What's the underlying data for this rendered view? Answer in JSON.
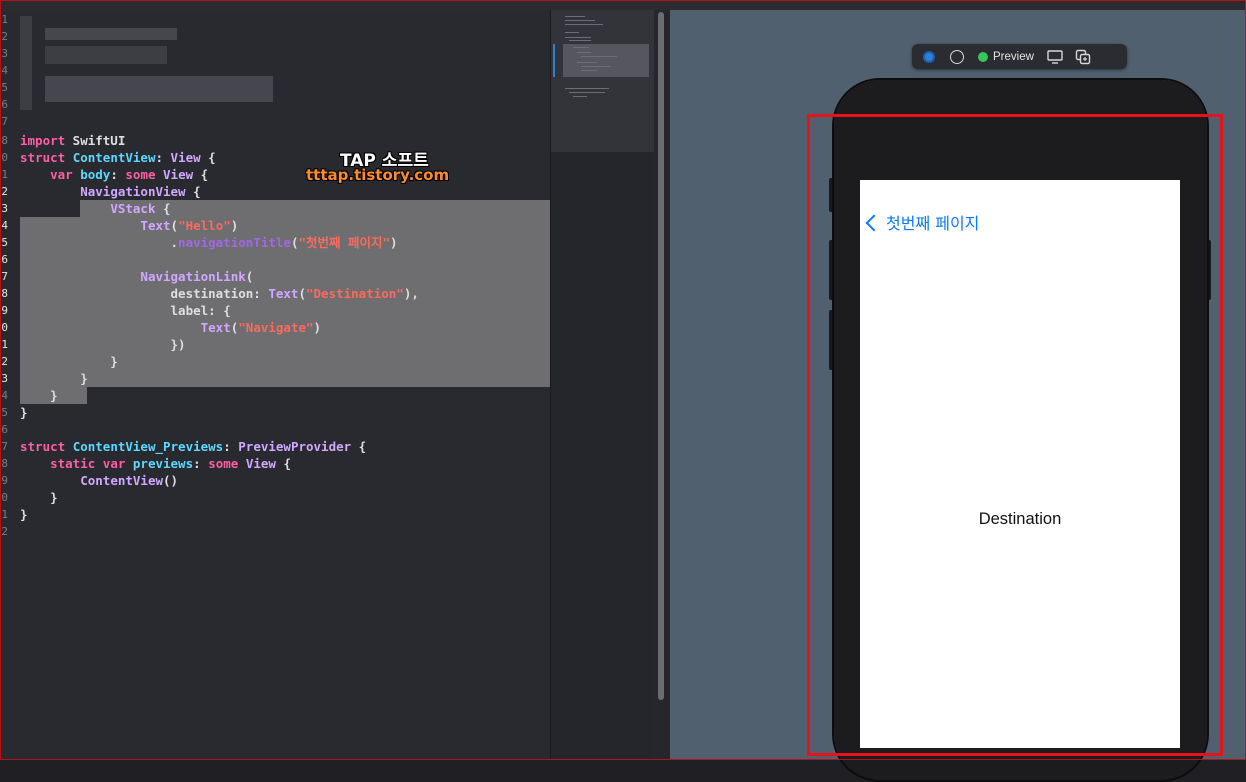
{
  "watermark": {
    "title": "TAP 소프트",
    "url": "tttap.tistory.com"
  },
  "code_lines": [
    {
      "n": "8",
      "tokens": [
        {
          "t": "import",
          "c": "kw"
        },
        {
          "t": " SwiftUI",
          "c": "plain"
        }
      ]
    },
    {
      "n": "0",
      "tokens": [
        {
          "t": "struct",
          "c": "kw"
        },
        {
          "t": " ",
          "c": "plain"
        },
        {
          "t": "ContentView",
          "c": "ty"
        },
        {
          "t": ": ",
          "c": "plain"
        },
        {
          "t": "View",
          "c": "ty2"
        },
        {
          "t": " {",
          "c": "plain"
        }
      ]
    },
    {
      "n": "1",
      "tokens": [
        {
          "t": "    ",
          "c": "plain"
        },
        {
          "t": "var",
          "c": "kw"
        },
        {
          "t": " ",
          "c": "plain"
        },
        {
          "t": "body",
          "c": "ty"
        },
        {
          "t": ": ",
          "c": "plain"
        },
        {
          "t": "some",
          "c": "kw"
        },
        {
          "t": " ",
          "c": "plain"
        },
        {
          "t": "View",
          "c": "ty2"
        },
        {
          "t": " {",
          "c": "plain"
        }
      ]
    },
    {
      "n": "2",
      "tokens": [
        {
          "t": "        ",
          "c": "plain"
        },
        {
          "t": "NavigationView",
          "c": "ty2"
        },
        {
          "t": " {",
          "c": "plain"
        }
      ]
    },
    {
      "n": "3",
      "tokens": [
        {
          "t": "            ",
          "c": "plain"
        },
        {
          "t": "VStack",
          "c": "ty2"
        },
        {
          "t": " {",
          "c": "plain"
        }
      ]
    },
    {
      "n": "4",
      "tokens": [
        {
          "t": "                ",
          "c": "plain"
        },
        {
          "t": "Text",
          "c": "ty2"
        },
        {
          "t": "(",
          "c": "plain"
        },
        {
          "t": "\"Hello\"",
          "c": "str"
        },
        {
          "t": ")",
          "c": "plain"
        }
      ]
    },
    {
      "n": "5",
      "tokens": [
        {
          "t": "                    .",
          "c": "plain"
        },
        {
          "t": "navigationTitle",
          "c": "mth"
        },
        {
          "t": "(",
          "c": "plain"
        },
        {
          "t": "\"첫번째 페이지\"",
          "c": "str"
        },
        {
          "t": ")",
          "c": "plain"
        }
      ]
    },
    {
      "n": "6",
      "tokens": []
    },
    {
      "n": "7",
      "tokens": [
        {
          "t": "                ",
          "c": "plain"
        },
        {
          "t": "NavigationLink",
          "c": "ty2"
        },
        {
          "t": "(",
          "c": "plain"
        }
      ]
    },
    {
      "n": "8",
      "tokens": [
        {
          "t": "                    destination: ",
          "c": "plain"
        },
        {
          "t": "Text",
          "c": "ty2"
        },
        {
          "t": "(",
          "c": "plain"
        },
        {
          "t": "\"Destination\"",
          "c": "str"
        },
        {
          "t": "),",
          "c": "plain"
        }
      ]
    },
    {
      "n": "9",
      "tokens": [
        {
          "t": "                    label: {",
          "c": "plain"
        }
      ]
    },
    {
      "n": "0",
      "tokens": [
        {
          "t": "                        ",
          "c": "plain"
        },
        {
          "t": "Text",
          "c": "ty2"
        },
        {
          "t": "(",
          "c": "plain"
        },
        {
          "t": "\"Navigate\"",
          "c": "str"
        },
        {
          "t": ")",
          "c": "plain"
        }
      ]
    },
    {
      "n": "1",
      "tokens": [
        {
          "t": "                    })",
          "c": "plain"
        }
      ]
    },
    {
      "n": "2",
      "tokens": [
        {
          "t": "            }",
          "c": "plain"
        }
      ]
    },
    {
      "n": "3",
      "tokens": [
        {
          "t": "        }",
          "c": "plain"
        }
      ]
    },
    {
      "n": "4",
      "tokens": [
        {
          "t": "    }",
          "c": "plain"
        }
      ]
    },
    {
      "n": "5",
      "tokens": [
        {
          "t": "}",
          "c": "plain"
        }
      ]
    },
    {
      "n": "6",
      "tokens": []
    },
    {
      "n": "7",
      "tokens": [
        {
          "t": "struct",
          "c": "kw"
        },
        {
          "t": " ",
          "c": "plain"
        },
        {
          "t": "ContentView_Previews",
          "c": "ty"
        },
        {
          "t": ": ",
          "c": "plain"
        },
        {
          "t": "PreviewProvider",
          "c": "ty2"
        },
        {
          "t": " {",
          "c": "plain"
        }
      ]
    },
    {
      "n": "8",
      "tokens": [
        {
          "t": "    ",
          "c": "plain"
        },
        {
          "t": "static",
          "c": "kw"
        },
        {
          "t": " ",
          "c": "plain"
        },
        {
          "t": "var",
          "c": "kw"
        },
        {
          "t": " ",
          "c": "plain"
        },
        {
          "t": "previews",
          "c": "ty"
        },
        {
          "t": ": ",
          "c": "plain"
        },
        {
          "t": "some",
          "c": "kw"
        },
        {
          "t": " ",
          "c": "plain"
        },
        {
          "t": "View",
          "c": "ty2"
        },
        {
          "t": " {",
          "c": "plain"
        }
      ]
    },
    {
      "n": "9",
      "tokens": [
        {
          "t": "        ",
          "c": "plain"
        },
        {
          "t": "ContentView",
          "c": "ty2"
        },
        {
          "t": "()",
          "c": "plain"
        }
      ]
    },
    {
      "n": "0",
      "tokens": [
        {
          "t": "    }",
          "c": "plain"
        }
      ]
    },
    {
      "n": "1",
      "tokens": [
        {
          "t": "}",
          "c": "plain"
        }
      ]
    },
    {
      "n": "2",
      "tokens": []
    }
  ],
  "top_line_numbers": [
    "1",
    "2",
    "3",
    "4",
    "5",
    "6",
    "7"
  ],
  "preview_toolbar": {
    "label": "Preview"
  },
  "device": {
    "back_label": "첫번째 페이지",
    "content_text": "Destination"
  }
}
